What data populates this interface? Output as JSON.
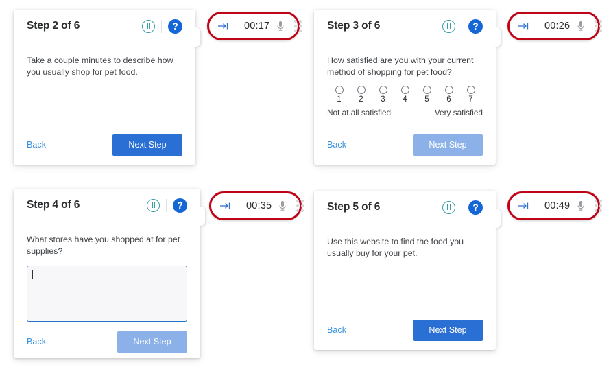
{
  "cards": [
    {
      "id": "step-2",
      "title": "Step 2 of 6",
      "prompt": "Take a couple minutes to describe how you usually shop for pet food.",
      "back_label": "Back",
      "next_label": "Next Step",
      "next_state": "enabled",
      "pause_icon": "pause-circle-icon",
      "help_icon": "help-circle-icon"
    },
    {
      "id": "step-3",
      "title": "Step 3 of 6",
      "prompt": "How satisfied are you with your current method of shopping for pet food?",
      "scale": {
        "options": [
          "1",
          "2",
          "3",
          "4",
          "5",
          "6",
          "7"
        ],
        "low_label": "Not at all satisfied",
        "high_label": "Very satisfied",
        "selected": null
      },
      "back_label": "Back",
      "next_label": "Next Step",
      "next_state": "disabled",
      "pause_icon": "pause-circle-icon",
      "help_icon": "help-circle-icon"
    },
    {
      "id": "step-4",
      "title": "Step 4 of 6",
      "prompt": "What stores have you shopped at for pet supplies?",
      "answer": {
        "value": "",
        "placeholder": "",
        "focused": true
      },
      "back_label": "Back",
      "next_label": "Next Step",
      "next_state": "disabled",
      "pause_icon": "pause-circle-icon",
      "help_icon": "help-circle-icon"
    },
    {
      "id": "step-5",
      "title": "Step 5 of 6",
      "prompt": "Use this website to find the food you usually buy for your pet.",
      "back_label": "Back",
      "next_label": "Next Step",
      "next_state": "enabled",
      "pause_icon": "pause-circle-icon",
      "help_icon": "help-circle-icon"
    }
  ],
  "recorders": [
    {
      "id": "rec-1",
      "time": "00:17",
      "skip_icon": "skip-to-end-icon",
      "record_dot": "recording-dot-icon",
      "mic_icon": "microphone-icon",
      "grip_icon": "drag-handle-icon"
    },
    {
      "id": "rec-2",
      "time": "00:26",
      "skip_icon": "skip-to-end-icon",
      "record_dot": "recording-dot-icon",
      "mic_icon": "microphone-icon",
      "grip_icon": "drag-handle-icon"
    },
    {
      "id": "rec-3",
      "time": "00:35",
      "skip_icon": "skip-to-end-icon",
      "record_dot": "recording-dot-icon",
      "mic_icon": "microphone-icon",
      "grip_icon": "drag-handle-icon"
    },
    {
      "id": "rec-4",
      "time": "00:49",
      "skip_icon": "skip-to-end-icon",
      "record_dot": "recording-dot-icon",
      "mic_icon": "microphone-icon",
      "grip_icon": "drag-handle-icon"
    }
  ],
  "help_glyph": "?",
  "colors": {
    "primary_button": "#2a6fd4",
    "disabled_button": "#8cb1e8",
    "link": "#3a93dd",
    "recorder_border": "#c00418",
    "record_dot": "#d1131f",
    "pause_ring": "#3a9ba8",
    "help_circle": "#1667d6",
    "focus_border": "#2574c4"
  }
}
